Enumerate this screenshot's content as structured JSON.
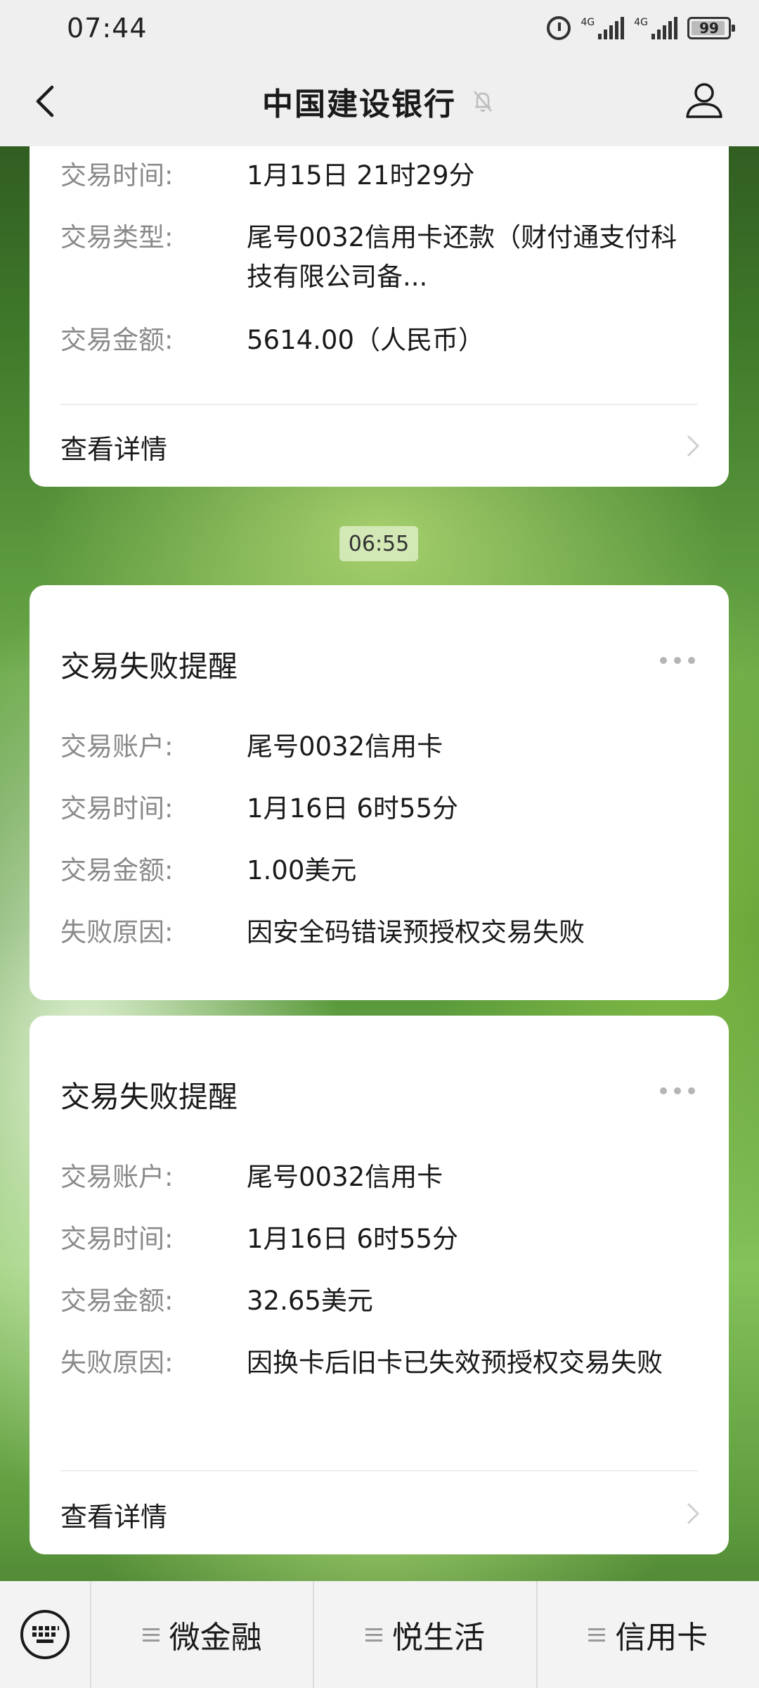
{
  "status_bar": {
    "time": "07:44",
    "network_1": "4G",
    "network_2": "4G",
    "battery": "99"
  },
  "header": {
    "title": "中国建设银行"
  },
  "message_1": {
    "rows": [
      {
        "key": "交易时间:",
        "value": "1月15日 21时29分"
      },
      {
        "key": "交易类型:",
        "value": "尾号0032信用卡还款（财付通支付科技有限公司备..."
      },
      {
        "key": "交易金额:",
        "value": "5614.00（人民币）"
      }
    ],
    "detail_link": "查看详情"
  },
  "timestamp": "06:55",
  "message_2": {
    "title": "交易失败提醒",
    "rows": [
      {
        "key": "交易账户:",
        "value": "尾号0032信用卡"
      },
      {
        "key": "交易时间:",
        "value": "1月16日 6时55分"
      },
      {
        "key": "交易金额:",
        "value": "1.00美元"
      },
      {
        "key": "失败原因:",
        "value": "因安全码错误预授权交易失败"
      }
    ]
  },
  "message_3": {
    "title": "交易失败提醒",
    "rows": [
      {
        "key": "交易账户:",
        "value": "尾号0032信用卡"
      },
      {
        "key": "交易时间:",
        "value": "1月16日 6时55分"
      },
      {
        "key": "交易金额:",
        "value": "32.65美元"
      },
      {
        "key": "失败原因:",
        "value": "因换卡后旧卡已失效预授权交易失败"
      }
    ],
    "detail_link": "查看详情"
  },
  "bottom_menu": {
    "items": [
      {
        "label": "微金融"
      },
      {
        "label": "悦生活"
      },
      {
        "label": "信用卡"
      }
    ]
  }
}
